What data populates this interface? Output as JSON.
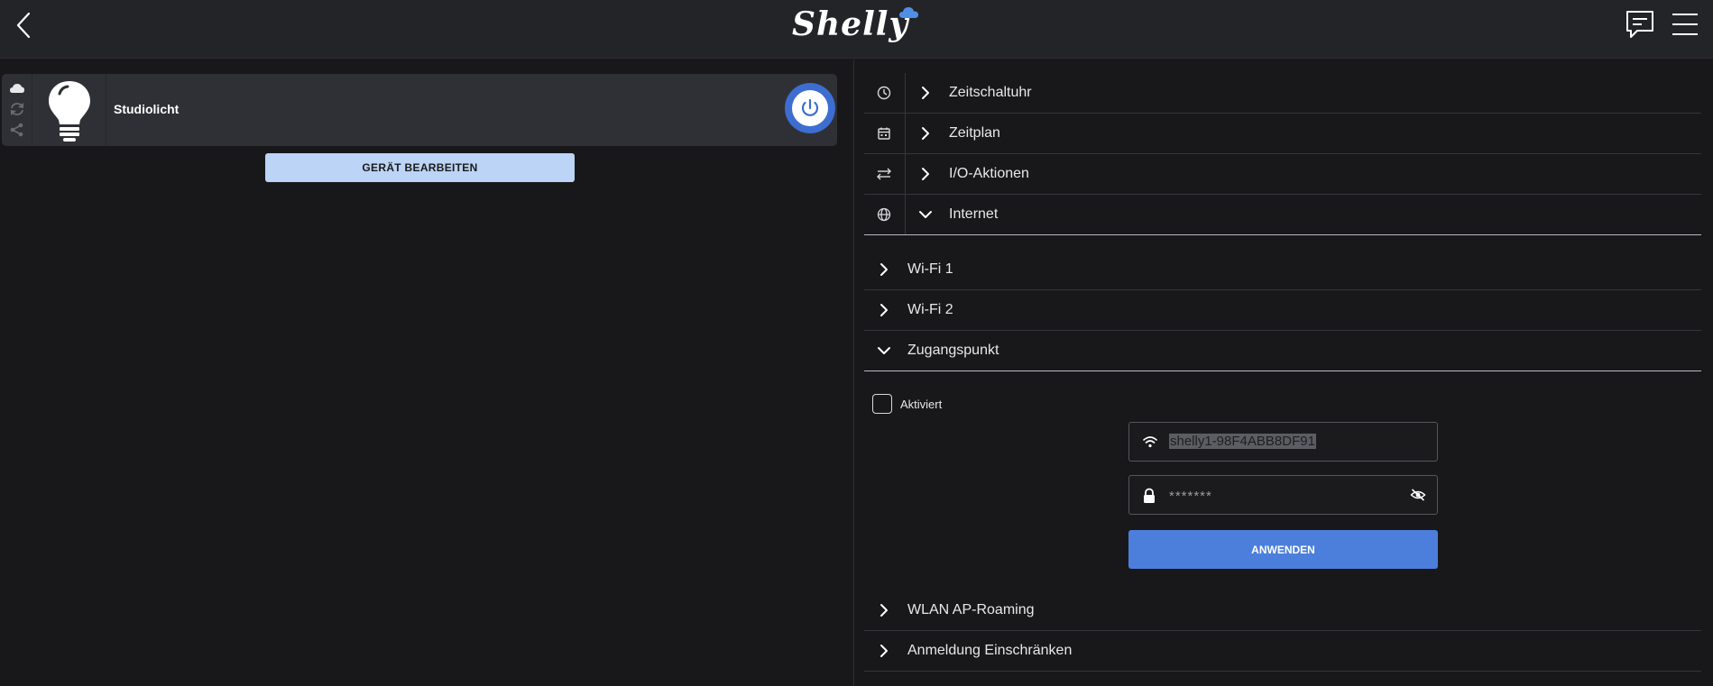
{
  "header": {
    "logo_text": "Shelly"
  },
  "device": {
    "name": "Studiolicht",
    "edit_label": "GERÄT BEARBEITEN"
  },
  "settings": {
    "main_rows": [
      {
        "label": "Zeitschaltuhr",
        "icon": "clock-icon",
        "expanded": false
      },
      {
        "label": "Zeitplan",
        "icon": "calendar-icon",
        "expanded": false
      },
      {
        "label": "I/O-Aktionen",
        "icon": "swap-arrows-icon",
        "expanded": false
      },
      {
        "label": "Internet",
        "icon": "globe-icon",
        "expanded": true
      }
    ],
    "internet_rows": [
      {
        "label": "Wi-Fi 1",
        "expanded": false
      },
      {
        "label": "Wi-Fi 2",
        "expanded": false
      },
      {
        "label": "Zugangspunkt",
        "expanded": true
      },
      {
        "label": "WLAN AP-Roaming",
        "expanded": false
      },
      {
        "label": "Anmeldung Einschränken",
        "expanded": false
      }
    ],
    "access_point": {
      "enabled_label": "Aktiviert",
      "enabled": false,
      "ssid_value": "shelly1-98F4ABB8DF91",
      "password_value": "*******",
      "apply_label": "ANWENDEN"
    }
  },
  "colors": {
    "accent": "#4c7fdc",
    "header_bg": "#232428",
    "page_bg": "#18181a",
    "card_bg": "#2f3035",
    "edit_button_bg": "#bcd4f5"
  }
}
